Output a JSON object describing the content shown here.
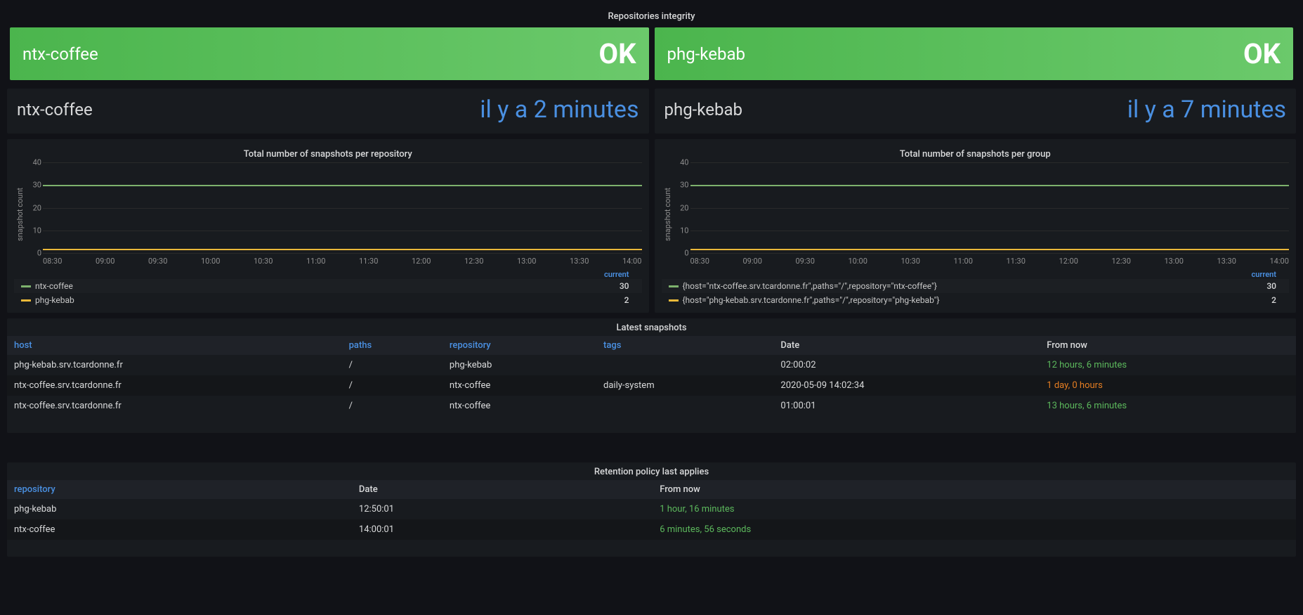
{
  "integrity": {
    "title": "Repositories integrity",
    "left": {
      "label": "ntx-coffee",
      "status": "OK"
    },
    "right": {
      "label": "phg-kebab",
      "status": "OK"
    }
  },
  "last_snapshot": {
    "left": {
      "label": "ntx-coffee",
      "value": "il y a 2 minutes"
    },
    "right": {
      "label": "phg-kebab",
      "value": "il y a 7 minutes"
    }
  },
  "chart_data": [
    {
      "type": "line",
      "title": "Total number of snapshots per repository",
      "ylabel": "snapshot count",
      "ylim": [
        0,
        40
      ],
      "y_ticks": [
        "0",
        "10",
        "20",
        "30",
        "40"
      ],
      "x_ticks": [
        "08:30",
        "09:00",
        "09:30",
        "10:00",
        "10:30",
        "11:00",
        "11:30",
        "12:00",
        "12:30",
        "13:00",
        "13:30",
        "14:00"
      ],
      "legend_header": "current",
      "series": [
        {
          "name": "ntx-coffee",
          "color": "#7eb26d",
          "value": 30
        },
        {
          "name": "phg-kebab",
          "color": "#eab839",
          "value": 2
        }
      ]
    },
    {
      "type": "line",
      "title": "Total number of snapshots per group",
      "ylabel": "snapshot count",
      "ylim": [
        0,
        40
      ],
      "y_ticks": [
        "0",
        "10",
        "20",
        "30",
        "40"
      ],
      "x_ticks": [
        "08:30",
        "09:00",
        "09:30",
        "10:00",
        "10:30",
        "11:00",
        "11:30",
        "12:00",
        "12:30",
        "13:00",
        "13:30",
        "14:00"
      ],
      "legend_header": "current",
      "series": [
        {
          "name": "{host=\"ntx-coffee.srv.tcardonne.fr\",paths=\"/\",repository=\"ntx-coffee\"}",
          "color": "#7eb26d",
          "value": 30
        },
        {
          "name": "{host=\"phg-kebab.srv.tcardonne.fr\",paths=\"/\",repository=\"phg-kebab\"}",
          "color": "#eab839",
          "value": 2
        }
      ]
    }
  ],
  "snapshots_table": {
    "title": "Latest snapshots",
    "columns": [
      "host",
      "paths",
      "repository",
      "tags",
      "Date",
      "From now"
    ],
    "rows": [
      {
        "host": "phg-kebab.srv.tcardonne.fr",
        "paths": "/",
        "repository": "phg-kebab",
        "tags": "",
        "date": "02:00:02",
        "from_now": "12 hours, 6 minutes",
        "from_now_class": "val-green"
      },
      {
        "host": "ntx-coffee.srv.tcardonne.fr",
        "paths": "/",
        "repository": "ntx-coffee",
        "tags": "daily-system",
        "date": "2020-05-09 14:02:34",
        "from_now": "1 day, 0 hours",
        "from_now_class": "val-orange"
      },
      {
        "host": "ntx-coffee.srv.tcardonne.fr",
        "paths": "/",
        "repository": "ntx-coffee",
        "tags": "",
        "date": "01:00:01",
        "from_now": "13 hours, 6 minutes",
        "from_now_class": "val-green"
      }
    ]
  },
  "retention_table": {
    "title": "Retention policy last applies",
    "columns": [
      "repository",
      "Date",
      "From now"
    ],
    "rows": [
      {
        "repository": "phg-kebab",
        "date": "12:50:01",
        "from_now": "1 hour, 16 minutes"
      },
      {
        "repository": "ntx-coffee",
        "date": "14:00:01",
        "from_now": "6 minutes, 56 seconds"
      }
    ]
  }
}
